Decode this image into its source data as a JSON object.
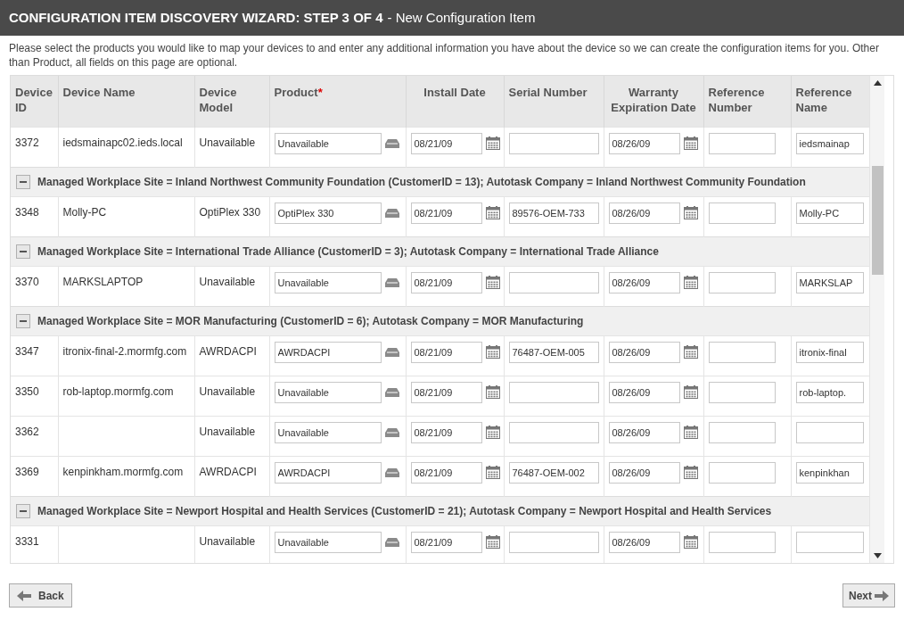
{
  "title_bar": {
    "title": "CONFIGURATION ITEM DISCOVERY WIZARD: STEP 3 OF 4",
    "subtitle": "- New Configuration Item"
  },
  "instructions": "Please select the products you would like to map your devices to and enter any additional information you have about the device so we can create the configuration items for you. Other than Product, all fields on this page are optional.",
  "table": {
    "columns": [
      {
        "label": "Device ID"
      },
      {
        "label": "Device Name"
      },
      {
        "label": "Device Model"
      },
      {
        "label": "Product",
        "required_mark": "*"
      },
      {
        "label": "Install Date"
      },
      {
        "label": "Serial Number"
      },
      {
        "label": "Warranty Expiration Date"
      },
      {
        "label": "Reference Number"
      },
      {
        "label": "Reference Name"
      }
    ],
    "rows": [
      {
        "kind": "device",
        "id": "3372",
        "name": "iedsmainapc02.ieds.local",
        "model": "Unavailable",
        "product": "Unavailable",
        "install": "08/21/09",
        "serial": "",
        "warranty": "08/26/09",
        "ref_number": "",
        "ref_name": "iedsmainap"
      },
      {
        "kind": "group",
        "expanded": true,
        "label": "Managed Workplace Site = Inland Northwest Community Foundation (CustomerID = 13); Autotask Company = Inland Northwest Community Foundation"
      },
      {
        "kind": "device",
        "id": "3348",
        "name": "Molly-PC",
        "model": "OptiPlex 330",
        "product": "OptiPlex 330",
        "install": "08/21/09",
        "serial": "89576-OEM-733",
        "warranty": "08/26/09",
        "ref_number": "",
        "ref_name": "Molly-PC"
      },
      {
        "kind": "group",
        "expanded": true,
        "label": "Managed Workplace Site = International Trade Alliance (CustomerID = 3); Autotask Company = International Trade Alliance"
      },
      {
        "kind": "device",
        "id": "3370",
        "name": "MARKSLAPTOP",
        "model": "Unavailable",
        "product": "Unavailable",
        "install": "08/21/09",
        "serial": "",
        "warranty": "08/26/09",
        "ref_number": "",
        "ref_name": "MARKSLAP"
      },
      {
        "kind": "group",
        "expanded": true,
        "label": "Managed Workplace Site = MOR Manufacturing (CustomerID = 6); Autotask Company = MOR Manufacturing"
      },
      {
        "kind": "device",
        "id": "3347",
        "name": "itronix-final-2.mormfg.com",
        "model": "AWRDACPI",
        "product": "AWRDACPI",
        "install": "08/21/09",
        "serial": "76487-OEM-005",
        "warranty": "08/26/09",
        "ref_number": "",
        "ref_name": "itronix-final"
      },
      {
        "kind": "device",
        "id": "3350",
        "name": "rob-laptop.mormfg.com",
        "model": "Unavailable",
        "product": "Unavailable",
        "install": "08/21/09",
        "serial": "",
        "warranty": "08/26/09",
        "ref_number": "",
        "ref_name": "rob-laptop."
      },
      {
        "kind": "device",
        "id": "3362",
        "name": "",
        "model": "Unavailable",
        "product": "Unavailable",
        "install": "08/21/09",
        "serial": "",
        "warranty": "08/26/09",
        "ref_number": "",
        "ref_name": ""
      },
      {
        "kind": "device",
        "id": "3369",
        "name": "kenpinkham.mormfg.com",
        "model": "AWRDACPI",
        "product": "AWRDACPI",
        "install": "08/21/09",
        "serial": "76487-OEM-002",
        "warranty": "08/26/09",
        "ref_number": "",
        "ref_name": "kenpinkhan"
      },
      {
        "kind": "group",
        "expanded": true,
        "label": "Managed Workplace Site = Newport Hospital and Health Services (CustomerID = 21); Autotask Company = Newport Hospital and Health Services"
      },
      {
        "kind": "device",
        "id": "3331",
        "name": "",
        "model": "Unavailable",
        "product": "Unavailable",
        "install": "08/21/09",
        "serial": "",
        "warranty": "08/26/09",
        "ref_number": "",
        "ref_name": ""
      }
    ]
  },
  "buttons": {
    "back": "Back",
    "next": "Next"
  }
}
